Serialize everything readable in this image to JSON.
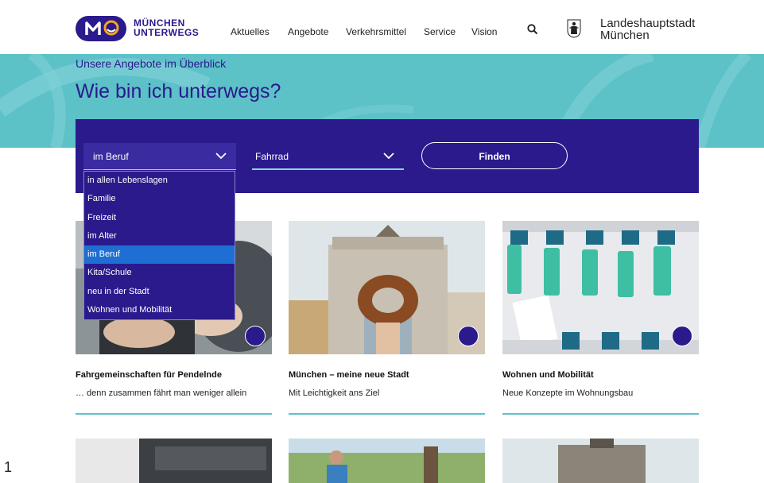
{
  "brand": {
    "logo_line1": "MÜNCHEN",
    "logo_line2": "UNTERWEGS"
  },
  "nav": {
    "items": [
      "Aktuelles",
      "Angebote",
      "Verkehrsmittel",
      "Service",
      "Vision"
    ],
    "city_line1": "Landeshauptstadt",
    "city_line2": "München"
  },
  "hero": {
    "subtitle": "Unsere Angebote im Überblick",
    "title": "Wie bin ich unterwegs?"
  },
  "filter": {
    "situation_value": "im Beruf",
    "transport_value": "Fahrrad",
    "find_label": "Finden",
    "options": [
      "in allen Lebenslagen",
      "Familie",
      "Freizeit",
      "im Alter",
      "im Beruf",
      "Kita/Schule",
      "neu in der Stadt",
      "Wohnen und Mobilität"
    ],
    "selected_option": "im Beruf"
  },
  "cards": [
    {
      "title": "Fahrgemeinschaften für Pendelnde",
      "subtitle": "… denn zusammen fährt man weniger allein"
    },
    {
      "title": "München – meine neue Stadt",
      "subtitle": "Mit Leichtigkeit ans Ziel"
    },
    {
      "title": "Wohnen und Mobilität",
      "subtitle": "Neue Konzepte im Wohnungsbau"
    }
  ],
  "page_number": "1",
  "colors": {
    "brand": "#2a1a8c",
    "teal": "#5dc1c8",
    "highlight": "#1e6fd4"
  }
}
